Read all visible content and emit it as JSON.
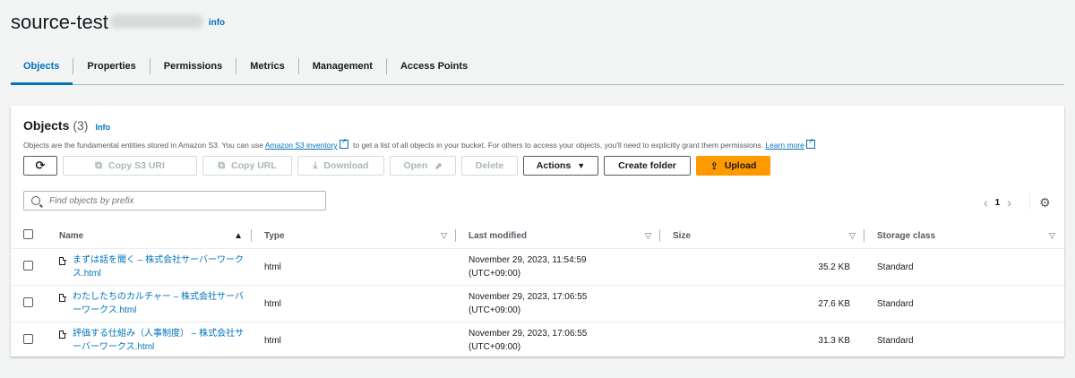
{
  "page": {
    "bucket_name": "source-test",
    "info": "info"
  },
  "tabs": [
    "Objects",
    "Properties",
    "Permissions",
    "Metrics",
    "Management",
    "Access Points"
  ],
  "objects_panel": {
    "title": "Objects",
    "count": "(3)",
    "info": "Info",
    "desc_pre": "Objects are the fundamental entities stored in Amazon S3. You can use",
    "desc_link": "Amazon S3 inventory",
    "desc_mid": "to get a list of all objects in your bucket. For others to access your objects, you'll need to explicitly grant them permissions.",
    "desc_learn": "Learn more"
  },
  "toolbar": {
    "copy_s3_uri": "Copy S3 URI",
    "copy_url": "Copy URL",
    "download": "Download",
    "open": "Open",
    "delete": "Delete",
    "actions": "Actions",
    "create_folder": "Create folder",
    "upload": "Upload"
  },
  "search": {
    "placeholder": "Find objects by prefix"
  },
  "pagination": {
    "current_page": "1"
  },
  "table": {
    "headers": {
      "name": "Name",
      "type": "Type",
      "last_modified": "Last modified",
      "size": "Size",
      "storage_class": "Storage class"
    },
    "rows": [
      {
        "name": "まずは話を聞く – 株式会社サーバーワークス.html",
        "type": "html",
        "last_modified": "November 29, 2023, 11:54:59 (UTC+09:00)",
        "size": "35.2 KB",
        "storage_class": "Standard"
      },
      {
        "name": "わたしたちのカルチャー – 株式会社サーバーワークス.html",
        "type": "html",
        "last_modified": "November 29, 2023, 17:06:55 (UTC+09:00)",
        "size": "27.6 KB",
        "storage_class": "Standard"
      },
      {
        "name": "評価する仕組み（人事制度） – 株式会社サーバーワークス.html",
        "type": "html",
        "last_modified": "November 29, 2023, 17:06:55 (UTC+09:00)",
        "size": "31.3 KB",
        "storage_class": "Standard"
      }
    ]
  },
  "colors": {
    "accent": "#0073bb",
    "primary_button": "#ff9900"
  }
}
